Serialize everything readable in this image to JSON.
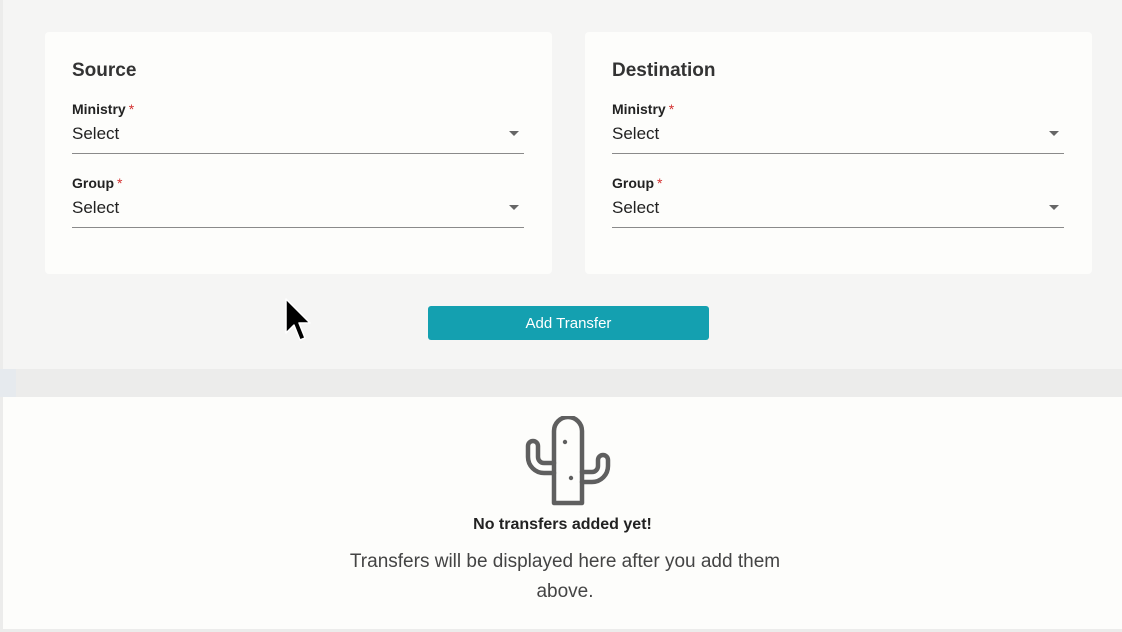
{
  "source": {
    "title": "Source",
    "ministry": {
      "label": "Ministry",
      "required": "*",
      "value": "Select"
    },
    "group": {
      "label": "Group",
      "required": "*",
      "value": "Select"
    }
  },
  "destination": {
    "title": "Destination",
    "ministry": {
      "label": "Ministry",
      "required": "*",
      "value": "Select"
    },
    "group": {
      "label": "Group",
      "required": "*",
      "value": "Select"
    }
  },
  "actions": {
    "add_transfer_label": "Add Transfer"
  },
  "empty_state": {
    "icon": "cactus-icon",
    "title": "No transfers added yet!",
    "description": "Transfers will be displayed here after you add them above."
  },
  "colors": {
    "accent": "#14a0b0",
    "required": "#d32f2f",
    "page_background": "#f5f5f4",
    "card_background": "#fdfdfb"
  }
}
